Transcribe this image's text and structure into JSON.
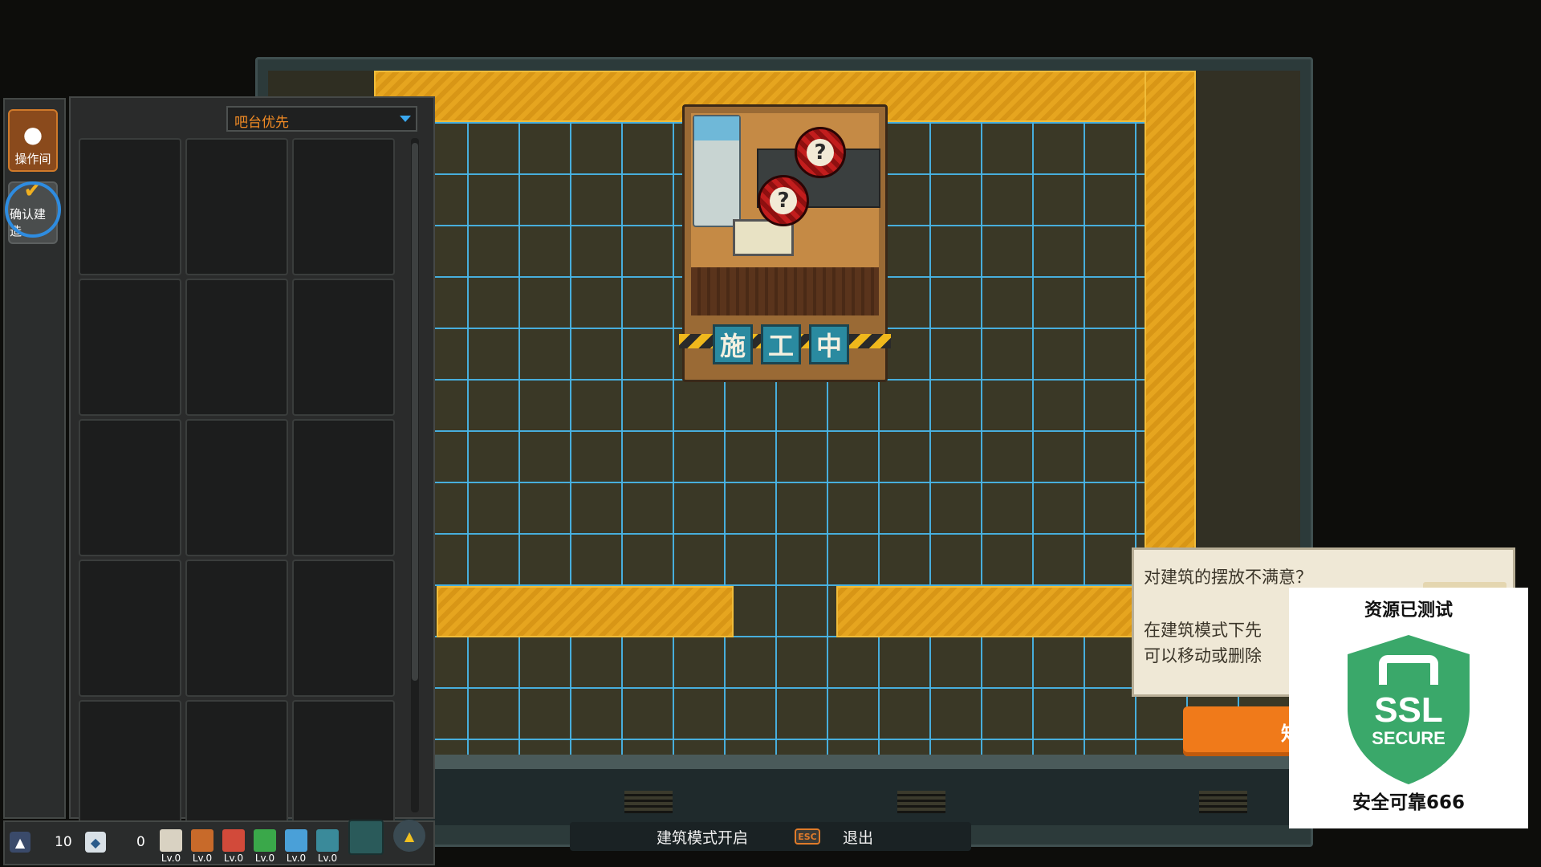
{
  "inventory": {
    "sort_label": "吧台优先",
    "slot_count": 15
  },
  "tools": {
    "ops_label": "操作间",
    "confirm_label": "确认建造"
  },
  "construction": {
    "tiles": [
      "施",
      "工",
      "中"
    ]
  },
  "resources": {
    "workers": "10",
    "gems": "0",
    "levels": [
      {
        "name": "house",
        "label": "Lv.0",
        "color": "#d9d2c2"
      },
      {
        "name": "counter",
        "label": "Lv.0",
        "color": "#c86a2a"
      },
      {
        "name": "checker-floor",
        "label": "Lv.0",
        "color": "#d24a3a"
      },
      {
        "name": "green-dome",
        "label": "Lv.0",
        "color": "#3aa84a"
      },
      {
        "name": "blue-tiles",
        "label": "Lv.0",
        "color": "#4aa0d8"
      },
      {
        "name": "tree",
        "label": "Lv.0",
        "color": "#3a8a9a"
      }
    ]
  },
  "status_bar": {
    "mode_text": "建筑模式开启",
    "esc_key": "ESC",
    "exit_text": "退出"
  },
  "tooltip": {
    "question": "对建筑的摆放不满意？",
    "line1": "在建筑模式下先",
    "line2": "可以移动或删除",
    "button_label": "知"
  },
  "ssl_badge": {
    "top_text": "资源已测试",
    "shield_text_1": "SSL",
    "shield_text_2": "SECURE",
    "bottom_text": "安全可靠666",
    "shield_color": "#3aa86a"
  }
}
